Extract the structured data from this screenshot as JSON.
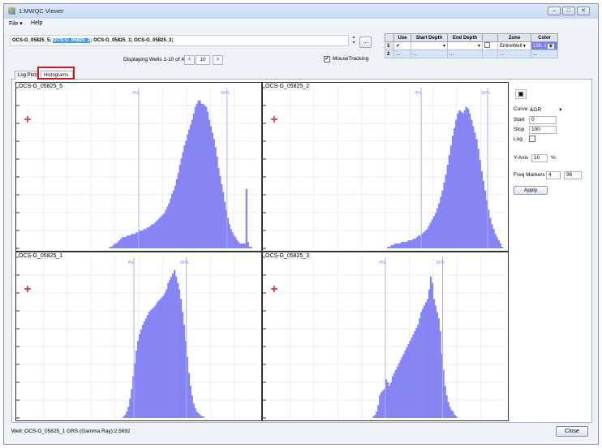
{
  "window": {
    "title": "1:MWQC Viewer"
  },
  "menu": [
    {
      "label": "File"
    },
    {
      "label": "Help"
    }
  ],
  "wells_selector": {
    "before": "OCS-G_05825_5; ",
    "selected": "OCS-G_05825_2",
    "after": "; OCS-G_05825_1; OCS-G_05825_3;",
    "browse_label": "..."
  },
  "nav": {
    "display_text": "Displaying Wells 1-10 of 4",
    "prev": "<",
    "next": ">",
    "page_size": "10"
  },
  "mouse_tracking": {
    "label": "MouseTracking",
    "checked": true
  },
  "depth_table": {
    "headers": [
      "",
      "Use",
      "Start Depth",
      "End Depth",
      "",
      "Zone",
      "Color"
    ],
    "rows": [
      {
        "id": "1",
        "use": "✔",
        "start": "",
        "end": "",
        "zone": "EntireWell",
        "color": "128, 1"
      },
      {
        "id": "2",
        "use": "",
        "start": "",
        "end": "",
        "zone": "",
        "color": ""
      }
    ],
    "new_row_marker": "..."
  },
  "tabs": [
    {
      "label": "Log Plots",
      "active": false
    },
    {
      "label": "Histograms",
      "active": true
    }
  ],
  "panels": [
    {
      "title": "OCS-G_05825_5",
      "p4_label": "4%",
      "p96_label": "96%",
      "bins": [
        0,
        0,
        0,
        0,
        0,
        0,
        0,
        0,
        0,
        0,
        0,
        0,
        0,
        0,
        0,
        0,
        0,
        0,
        0,
        0,
        0,
        0,
        0,
        0,
        0,
        0,
        0,
        0,
        0,
        0,
        0,
        0,
        0,
        0,
        0,
        0,
        0,
        0,
        0,
        0,
        0,
        0,
        0,
        0,
        0,
        0,
        0,
        0,
        0,
        0,
        0,
        0,
        0,
        0,
        0,
        0,
        0,
        0,
        1,
        1,
        2,
        3,
        3,
        4,
        5,
        6,
        7,
        7,
        7,
        8,
        8,
        8,
        9,
        9,
        9,
        10,
        10,
        11,
        11,
        11,
        12,
        12,
        13,
        13,
        14,
        15,
        15,
        16,
        17,
        18,
        19,
        20,
        21,
        22,
        24,
        26,
        28,
        31,
        34,
        36,
        39,
        43,
        47,
        52,
        56,
        60,
        64,
        67,
        71,
        74,
        77,
        80,
        84,
        88,
        90,
        92,
        92,
        90,
        90,
        89,
        88,
        85,
        80,
        76,
        72,
        68,
        63,
        57,
        50,
        45,
        40,
        35,
        29,
        24,
        19,
        15,
        12,
        10,
        8,
        7,
        5,
        4,
        3,
        3,
        3,
        3,
        37,
        4,
        1,
        1,
        0,
        0,
        0,
        0
      ]
    },
    {
      "title": "OCS-G_05825_2",
      "p4_label": "4%",
      "p96_label": "96%",
      "bins": [
        0,
        0,
        0,
        0,
        0,
        0,
        0,
        0,
        0,
        0,
        0,
        0,
        0,
        0,
        0,
        0,
        0,
        0,
        0,
        0,
        0,
        0,
        0,
        0,
        0,
        0,
        0,
        0,
        0,
        0,
        0,
        0,
        0,
        0,
        0,
        0,
        0,
        0,
        0,
        0,
        0,
        0,
        0,
        0,
        0,
        0,
        0,
        0,
        0,
        0,
        0,
        0,
        0,
        0,
        0,
        0,
        0,
        0,
        0,
        0,
        0,
        0,
        0,
        0,
        0,
        0,
        0,
        0,
        0,
        0,
        0,
        1,
        1,
        2,
        2,
        3,
        3,
        3,
        3,
        4,
        4,
        4,
        4,
        5,
        5,
        5,
        6,
        6,
        7,
        8,
        8,
        9,
        10,
        11,
        12,
        14,
        16,
        18,
        20,
        22,
        25,
        28,
        32,
        36,
        41,
        46,
        52,
        58,
        64,
        70,
        75,
        80,
        84,
        86,
        85,
        84,
        86,
        88,
        87,
        84,
        80,
        76,
        72,
        68,
        62,
        55,
        48,
        42,
        36,
        30,
        24,
        19,
        15,
        12,
        9,
        7,
        5,
        3,
        1,
        0
      ]
    },
    {
      "title": "OCS-G_05825_1",
      "p4_label": "4%",
      "p96_label": "96%",
      "bins": [
        0,
        0,
        0,
        0,
        0,
        0,
        0,
        0,
        0,
        0,
        0,
        0,
        0,
        0,
        0,
        0,
        0,
        0,
        0,
        0,
        0,
        0,
        0,
        0,
        0,
        0,
        0,
        0,
        0,
        0,
        0,
        0,
        0,
        0,
        0,
        0,
        0,
        0,
        0,
        0,
        0,
        0,
        0,
        0,
        0,
        0,
        0,
        0,
        0,
        0,
        0,
        0,
        0,
        0,
        0,
        0,
        0,
        0,
        0,
        0,
        0,
        0,
        0,
        0,
        0,
        1,
        2,
        4,
        7,
        12,
        18,
        26,
        34,
        42,
        48,
        52,
        55,
        58,
        60,
        62,
        64,
        66,
        67,
        68,
        69,
        70,
        72,
        73,
        74,
        75,
        76,
        78,
        80,
        84,
        86,
        88,
        90,
        92,
        88,
        84,
        80,
        74,
        66,
        58,
        48,
        38,
        28,
        20,
        14,
        9,
        6,
        4,
        3,
        2,
        1,
        1,
        0,
        0,
        0,
        0,
        0,
        0,
        0,
        0,
        0,
        0,
        0,
        0,
        0,
        0,
        0,
        0,
        0,
        0,
        0,
        0,
        0,
        0,
        0,
        0,
        0,
        0,
        0,
        0,
        0,
        0,
        0,
        0,
        0,
        0
      ]
    },
    {
      "title": "OCS-G_05825_3",
      "p4_label": "4%",
      "p96_label": "96%",
      "bins": [
        0,
        0,
        0,
        0,
        0,
        0,
        0,
        0,
        0,
        0,
        0,
        0,
        0,
        0,
        0,
        0,
        0,
        0,
        0,
        0,
        0,
        0,
        0,
        0,
        0,
        0,
        0,
        0,
        0,
        0,
        0,
        0,
        0,
        0,
        0,
        0,
        0,
        0,
        0,
        0,
        0,
        0,
        0,
        0,
        0,
        0,
        0,
        0,
        0,
        0,
        0,
        0,
        0,
        0,
        0,
        0,
        0,
        0,
        0,
        0,
        0,
        0,
        0,
        0,
        0,
        0,
        0,
        1,
        2,
        4,
        8,
        14,
        16,
        17,
        18,
        24,
        22,
        20,
        22,
        26,
        28,
        30,
        32,
        34,
        36,
        38,
        40,
        42,
        44,
        46,
        48,
        50,
        52,
        54,
        56,
        58,
        62,
        66,
        68,
        70,
        72,
        74,
        80,
        88,
        84,
        74,
        70,
        66,
        62,
        54,
        40,
        30,
        20,
        14,
        10,
        7,
        5,
        4,
        2,
        1,
        0,
        0,
        0,
        0,
        0,
        0,
        0,
        0,
        0,
        0,
        0,
        0,
        0,
        0,
        0,
        0,
        0,
        0,
        0,
        0,
        0,
        0,
        0,
        0,
        0,
        0,
        0,
        0,
        0,
        0
      ]
    }
  ],
  "controls": {
    "curve_label": "Curve",
    "curve_value": "&GR",
    "start_label": "Start",
    "start_value": "0",
    "stop_label": "Stop",
    "stop_value": "100",
    "log_label": "Log",
    "yaxis_label": "Y-Axis",
    "yaxis_value": "10",
    "yaxis_unit": "%",
    "freq_label": "Freq Markers",
    "freq_low": "4",
    "freq_high": "96",
    "apply_label": "Apply"
  },
  "status": {
    "text": "Well: OCS-G_05825_1   GRS (Gamma Ray):2.5692"
  },
  "close_label": "Close",
  "colors": {
    "bar": "#8585f5",
    "marker": "#aab0ee",
    "plus": "#dd2222",
    "grid": "#ececf4"
  }
}
